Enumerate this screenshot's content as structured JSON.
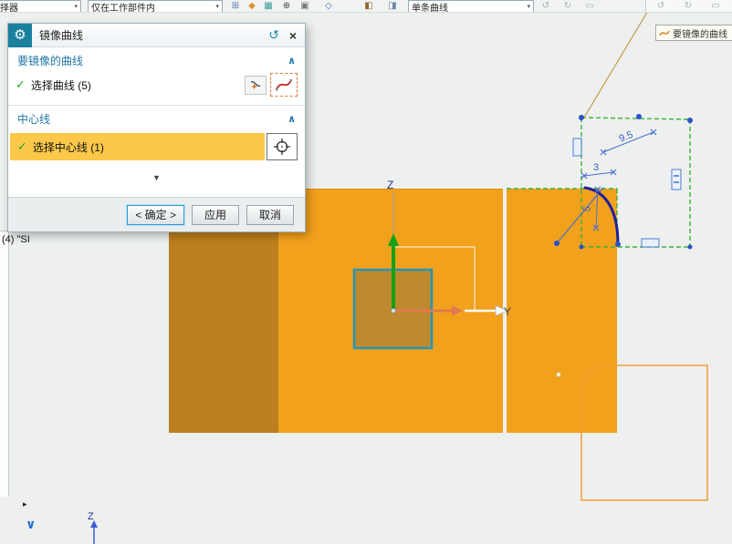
{
  "toolbar": {
    "filter_dropdown": "选择器",
    "scope_dropdown": "仅在工作部件内",
    "curve_rule_dropdown": "单条曲线",
    "icons": [
      {
        "name": "datum-plane-icon",
        "glyph": "⊞"
      },
      {
        "name": "snap-point-icon",
        "glyph": "◆"
      },
      {
        "name": "grid-snap-icon",
        "glyph": "▦"
      },
      {
        "name": "snap-center-icon",
        "glyph": "⊕"
      },
      {
        "name": "snap-intersection-icon",
        "glyph": "▣"
      },
      {
        "name": "snap-quadrant-icon",
        "glyph": "◇"
      },
      {
        "name": "shaded-view-icon",
        "glyph": "◧"
      },
      {
        "name": "wireframe-view-icon",
        "glyph": "◨"
      },
      {
        "name": "undo-icon",
        "glyph": "↺"
      },
      {
        "name": "redo-icon",
        "glyph": "↻"
      },
      {
        "name": "window-icon",
        "glyph": "▭"
      }
    ]
  },
  "tooltip": {
    "text": "要镜像的曲线"
  },
  "dialog": {
    "title": "镜像曲线",
    "curves_section": "要镜像的曲线",
    "select_curves": "选择曲线 (5)",
    "centerline_section": "中心线",
    "select_centerline": "选择中心线 (1)",
    "ok": "< 确定 >",
    "apply": "应用",
    "cancel": "取消"
  },
  "tree": {
    "item": "(4) \"SI"
  },
  "viewport": {
    "axis_z": "Z",
    "axis_y": "Y",
    "triad_z": "Z",
    "dim_width": "9.5",
    "dim_offset": "3",
    "dim_radius": "5"
  },
  "icons": {
    "gear": "⚙",
    "reset": "↺",
    "close": "×",
    "check": "✓",
    "chevron_up": "∧",
    "dropdown": "▾",
    "expand_down": "▼",
    "panel_arrow": "▸",
    "double_chevron": "∨"
  },
  "colors": {
    "accent_blue": "#2277a8",
    "highlight_yellow": "#fbc84a",
    "part_orange": "#f2a11c",
    "part_dark_orange": "#bd7f1f",
    "selected_green": "#3db03d",
    "sketch_blue": "#4a6fd0",
    "preview_orange": "#f59d33",
    "titlebar_teal": "#1b7f9e"
  }
}
